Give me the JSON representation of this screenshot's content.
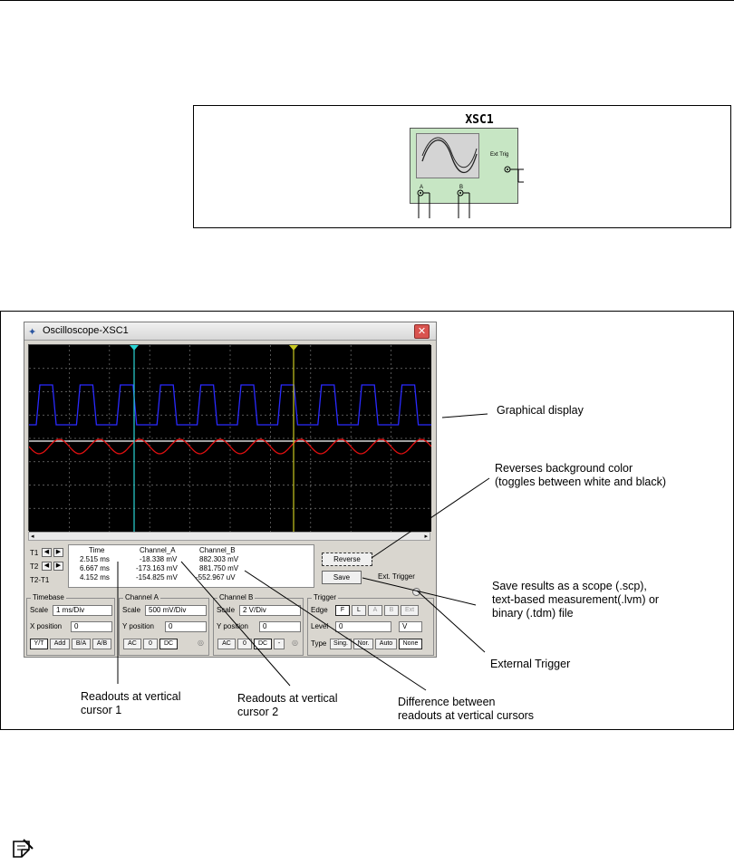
{
  "symbol": {
    "title": "XSC1",
    "ext_trig": "Ext Trig",
    "channel_a": "A",
    "channel_b": "B"
  },
  "window": {
    "title": "Oscilloscope-XSC1",
    "close": "✕"
  },
  "readout": {
    "rows": [
      "T1",
      "T2",
      "T2-T1"
    ],
    "headers": [
      "Time",
      "Channel_A",
      "Channel_B"
    ],
    "t1": [
      "2.515 ms",
      "-18.338 mV",
      "882.303 mV"
    ],
    "t2": [
      "6.667 ms",
      "-173.163 mV",
      "881.750 mV"
    ],
    "diff": [
      "4.152 ms",
      "-154.825 mV",
      "-552.967 uV"
    ]
  },
  "buttons": {
    "reverse": "Reverse",
    "save": "Save",
    "ext_trigger": "Ext. Trigger"
  },
  "timebase": {
    "title": "Timebase",
    "scale_label": "Scale",
    "scale_value": "1 ms/Div",
    "xpos_label": "X position",
    "xpos_value": "0",
    "modes": [
      "Y/T",
      "Add",
      "B/A",
      "A/B"
    ]
  },
  "channel_a": {
    "title": "Channel A",
    "scale_label": "Scale",
    "scale_value": "500 mV/Div",
    "ypos_label": "Y position",
    "ypos_value": "0",
    "coupling": [
      "AC",
      "0",
      "DC"
    ]
  },
  "channel_b": {
    "title": "Channel B",
    "scale_label": "Scale",
    "scale_value": "2  V/Div",
    "ypos_label": "Y position",
    "ypos_value": "0",
    "coupling": [
      "AC",
      "0",
      "DC",
      "-"
    ]
  },
  "trigger": {
    "title": "Trigger",
    "edge_label": "Edge",
    "edge_buttons": [
      "F",
      "L",
      "A",
      "B",
      "Ext"
    ],
    "level_label": "Level",
    "level_value": "0",
    "level_unit": "V",
    "type_label": "Type",
    "types": [
      "Sing.",
      "Nor.",
      "Auto",
      "None"
    ]
  },
  "annotations": {
    "display": "Graphical display",
    "reverse": [
      "Reverses background color",
      "(toggles between white and black)"
    ],
    "save": [
      "Save results as a scope (.scp),",
      "text-based measurement(.lvm) or",
      "binary (.tdm) file"
    ],
    "ext": "External Trigger",
    "cursor1": [
      "Readouts at vertical",
      "cursor 1"
    ],
    "cursor2": [
      "Readouts at vertical",
      "cursor 2"
    ],
    "diff": [
      "Difference between",
      "readouts at vertical cursors"
    ]
  },
  "colors": {
    "channel_a": "#e01010",
    "channel_b": "#2a2aff",
    "cursor1": "#2ad4d4",
    "cursor2": "#c8c820",
    "screen": "#000000"
  }
}
